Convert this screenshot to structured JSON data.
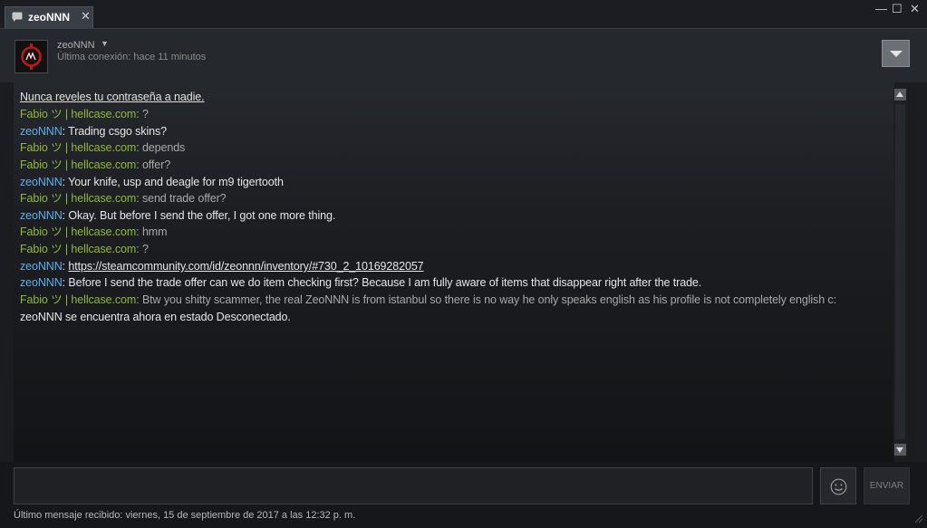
{
  "window": {
    "tab_title": "zeoNNN",
    "tab_close": "✕",
    "minimize": "—",
    "maximize": "☐",
    "close": "✕"
  },
  "header": {
    "friend_name": "zeoNNN",
    "caret": "▼",
    "last_seen": "Última conexión: hace 11 minutos",
    "avatar_icon": "nn-logo-avatar",
    "menu_icon": "dropdown-triangle-icon"
  },
  "chat": {
    "warning": "Nunca reveles tu contraseña a nadie.",
    "messages": [
      {
        "sender": "Fabio ツ | hellcase.com",
        "sep": ": ",
        "text": "?"
      },
      {
        "sender": "zeoNNN",
        "sep": ": ",
        "text": "Trading csgo skins?"
      },
      {
        "sender": "Fabio ツ | hellcase.com",
        "sep": ": ",
        "text": "depends"
      },
      {
        "sender": "Fabio ツ | hellcase.com",
        "sep": ": ",
        "text": "offer?"
      },
      {
        "sender": "zeoNNN",
        "sep": ": ",
        "text": "Your knife, usp and deagle for m9 tigertooth"
      },
      {
        "sender": "Fabio ツ | hellcase.com",
        "sep": ": ",
        "text": "send trade offer?"
      },
      {
        "sender": "zeoNNN",
        "sep": ": ",
        "text": "Okay. But before I send the offer, I got one more thing."
      },
      {
        "sender": "Fabio ツ | hellcase.com",
        "sep": ": ",
        "text": "hmm"
      },
      {
        "sender": "Fabio ツ | hellcase.com",
        "sep": ": ",
        "text": "?"
      },
      {
        "sender": "zeoNNN",
        "sep": ": ",
        "text": "https://steamcommunity.com/id/zeonnn/inventory/#730_2_10169282057"
      },
      {
        "sender": "zeoNNN",
        "sep": ": ",
        "text": "Before I send the trade offer can we do item checking first? Because I am fully aware of items that disappear right after the trade."
      },
      {
        "sender": "Fabio ツ | hellcase.com",
        "sep": ": ",
        "text": "Btw you shitty scammer, the real ZeoNNN is from istanbul so there is no way he only speaks english as his profile is not completely english c:"
      }
    ],
    "system_message": "zeoNNN se encuentra ahora en estado Desconectado."
  },
  "input": {
    "value": "",
    "emoji_icon": "smiley-icon",
    "send_label": "ENVIAR"
  },
  "footer": {
    "last_message": "Último mensaje recibido: viernes, 15 de septiembre de 2017 a las 12:32 p. m."
  },
  "colors": {
    "friend_name": "#8fb93b",
    "self_name": "#62b1ea",
    "background": "#1a1c20"
  }
}
